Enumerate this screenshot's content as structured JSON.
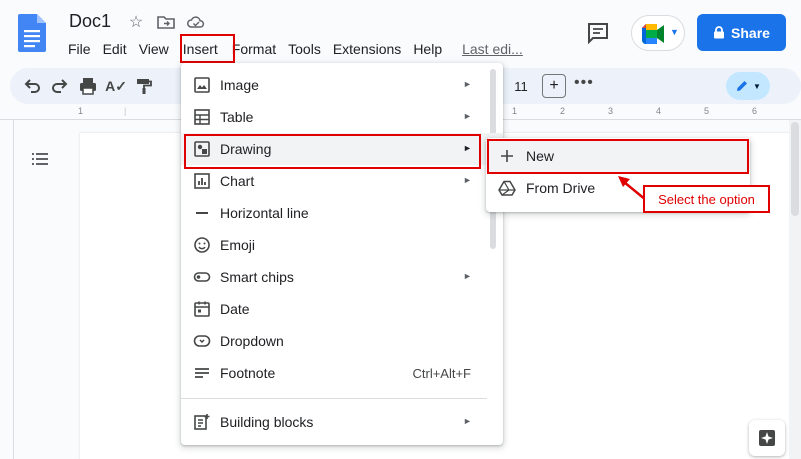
{
  "header": {
    "doc_title": "Doc1",
    "share_label": "Share",
    "menu": [
      "File",
      "Edit",
      "View",
      "Insert",
      "Format",
      "Tools",
      "Extensions",
      "Help"
    ],
    "last_edit": "Last edi..."
  },
  "toolbar": {
    "font_size": "11"
  },
  "ruler": {
    "numbers": [
      "1",
      "1",
      "2",
      "3",
      "4",
      "5",
      "6"
    ]
  },
  "insert_menu": {
    "items": [
      {
        "label": "Image",
        "icon": "image-icon",
        "submenu": true
      },
      {
        "label": "Table",
        "icon": "table-icon",
        "submenu": true
      },
      {
        "label": "Drawing",
        "icon": "drawing-icon",
        "submenu": true
      },
      {
        "label": "Chart",
        "icon": "chart-icon",
        "submenu": true
      },
      {
        "label": "Horizontal line",
        "icon": "horizontal-line-icon",
        "submenu": false
      },
      {
        "label": "Emoji",
        "icon": "emoji-icon",
        "submenu": false
      },
      {
        "label": "Smart chips",
        "icon": "smart-chips-icon",
        "submenu": true
      },
      {
        "label": "Date",
        "icon": "calendar-icon",
        "submenu": false
      },
      {
        "label": "Dropdown",
        "icon": "dropdown-icon",
        "submenu": false
      },
      {
        "label": "Footnote",
        "icon": "footnote-icon",
        "submenu": false,
        "shortcut": "Ctrl+Alt+F"
      },
      {
        "label": "Building blocks",
        "icon": "building-blocks-icon",
        "submenu": true
      }
    ],
    "highlighted": "Drawing"
  },
  "drawing_submenu": {
    "items": [
      {
        "label": "New",
        "icon": "plus-icon"
      },
      {
        "label": "From Drive",
        "icon": "google-drive-icon"
      }
    ]
  },
  "annotation": {
    "callout_text": "Select the option",
    "color": "#e00000"
  },
  "colors": {
    "share_blue": "#1a73e8",
    "menu_highlight": "#f1f3f4",
    "edit_mode_bg": "#c2e7ff"
  }
}
